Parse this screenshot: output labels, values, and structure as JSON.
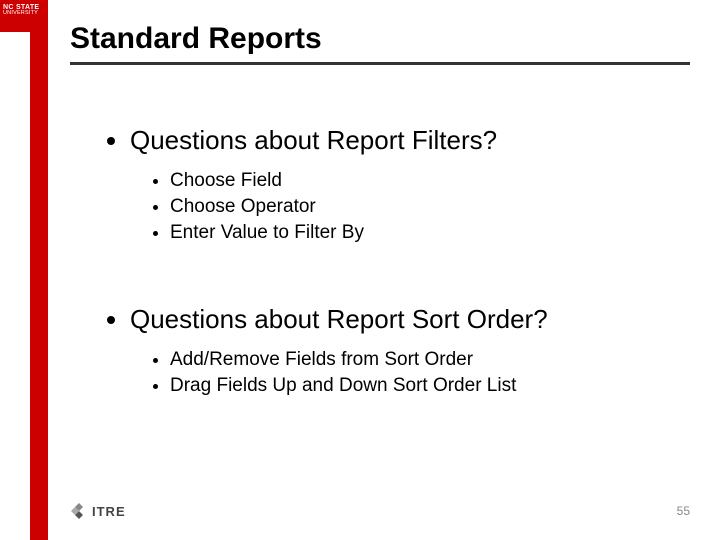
{
  "logo": {
    "line1": "NC STATE",
    "line2": "UNIVERSITY"
  },
  "title": "Standard Reports",
  "sections": [
    {
      "heading": "Questions about Report Filters?",
      "items": [
        "Choose Field",
        "Choose Operator",
        "Enter Value to Filter By"
      ]
    },
    {
      "heading": "Questions about Report Sort Order?",
      "items": [
        "Add/Remove Fields from Sort Order",
        "Drag Fields Up and Down Sort Order List"
      ]
    }
  ],
  "footer": {
    "org": "ITRE"
  },
  "page_number": "55"
}
